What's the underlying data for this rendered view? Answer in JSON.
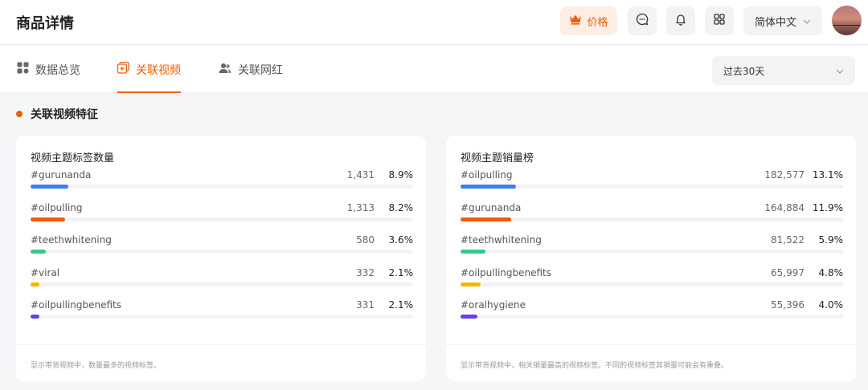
{
  "header": {
    "title": "商品详情",
    "price_label": "价格",
    "language_label": "简体中文",
    "accent": "#f25c05"
  },
  "tabs": [
    {
      "label": "数据总览",
      "icon": "dashboard-icon",
      "active": false
    },
    {
      "label": "关联视频",
      "icon": "video-icon",
      "active": true
    },
    {
      "label": "关联网红",
      "icon": "users-icon",
      "active": false
    }
  ],
  "date_range": {
    "value": "过去30天"
  },
  "section": {
    "title": "关联视频特征"
  },
  "cards": [
    {
      "title": "视频主题标签数量",
      "note": "显示带货视频中，数量最多的视频标签。",
      "rows": [
        {
          "tag": "#gurunanda",
          "count": "1,431",
          "pct": "8.9%",
          "pct_value": 8.9,
          "color": "#3f7cf3"
        },
        {
          "tag": "#oilpulling",
          "count": "1,313",
          "pct": "8.2%",
          "pct_value": 8.2,
          "color": "#f25c05"
        },
        {
          "tag": "#teethwhitening",
          "count": "580",
          "pct": "3.6%",
          "pct_value": 3.6,
          "color": "#32c98b"
        },
        {
          "tag": "#viral",
          "count": "332",
          "pct": "2.1%",
          "pct_value": 2.1,
          "color": "#f7b500"
        },
        {
          "tag": "#oilpullingbenefits",
          "count": "331",
          "pct": "2.1%",
          "pct_value": 2.1,
          "color": "#6a3df0"
        }
      ]
    },
    {
      "title": "视频主题销量榜",
      "note": "显示带货视频中，相关销量最高的视频标签。不同的视频标签其销量可能会有重叠。",
      "rows": [
        {
          "tag": "#oilpulling",
          "count": "182,577",
          "pct": "13.1%",
          "pct_value": 13.1,
          "color": "#3f7cf3"
        },
        {
          "tag": "#gurunanda",
          "count": "164,884",
          "pct": "11.9%",
          "pct_value": 11.9,
          "color": "#f25c05"
        },
        {
          "tag": "#teethwhitening",
          "count": "81,522",
          "pct": "5.9%",
          "pct_value": 5.9,
          "color": "#32c98b"
        },
        {
          "tag": "#oilpullingbenefits",
          "count": "65,997",
          "pct": "4.8%",
          "pct_value": 4.8,
          "color": "#f7b500"
        },
        {
          "tag": "#oralhygiene",
          "count": "55,396",
          "pct": "4.0%",
          "pct_value": 4.0,
          "color": "#6a3df0"
        }
      ]
    }
  ]
}
